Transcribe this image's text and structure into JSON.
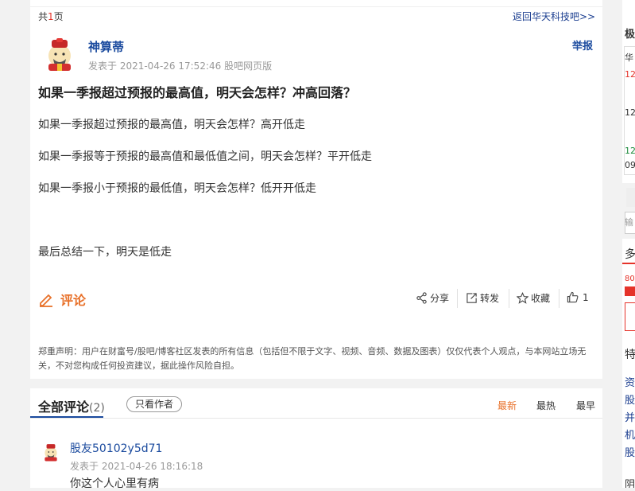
{
  "pagination": {
    "prefix": "共",
    "num": "1",
    "suffix": "页"
  },
  "back_link": "返回华天科技吧>>",
  "post": {
    "author": "神算蒂",
    "meta": "发表于 2021-04-26 17:52:46 股吧网页版",
    "report": "举报",
    "title": "如果一季报超过预报的最高值，明天会怎样？冲高回落？",
    "paragraphs": [
      "如果一季报超过预报的最高值，明天会怎样？高开低走",
      "如果一季报等于预报的最高值和最低值之间，明天会怎样？平开低走",
      "如果一季报小于预报的最低值，明天会怎样？低开开低走",
      "最后总结一下，明天是低走"
    ],
    "comment_label": "评论",
    "actions": {
      "share": "分享",
      "forward": "转发",
      "collect": "收藏",
      "like_count": "1"
    },
    "disclaimer": "郑重声明：用户在财富号/股吧/博客社区发表的所有信息（包括但不限于文字、视频、音频、数据及图表）仅仅代表个人观点，与本网站立场无关，不对您构成任何投资建议，据此操作风险自担。"
  },
  "comments": {
    "title": "全部评论",
    "count": "(2)",
    "author_only": "只看作者",
    "sort": [
      "最新",
      "最热",
      "最早"
    ],
    "items": [
      {
        "user": "股友50102y5d71",
        "time": "发表于 2021-04-26 18:16:18",
        "text": "你这个人心里有病"
      }
    ]
  },
  "sidebar": {
    "lines": [
      "极",
      "华",
      "12",
      "12",
      "12",
      "09",
      "输",
      "多",
      "80",
      "特",
      "资",
      "股",
      "并",
      "机",
      "股",
      "阴"
    ]
  },
  "colors": {
    "link": "#1a4a9e",
    "accent": "#e8712a",
    "red": "#e5332a"
  }
}
